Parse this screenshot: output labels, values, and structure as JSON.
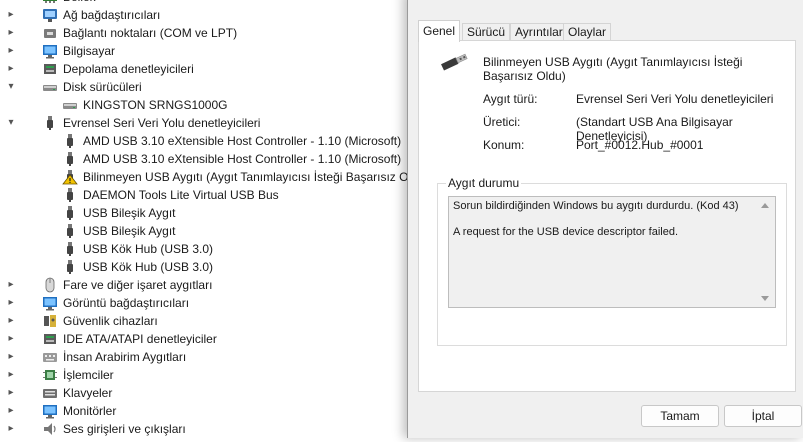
{
  "tree": {
    "items": [
      {
        "label": "Bellek",
        "indent": 0,
        "chevron": "▸",
        "icon": "mem"
      },
      {
        "label": "Ağ bağdaştırıcıları",
        "indent": 0,
        "chevron": "▸",
        "icon": "net"
      },
      {
        "label": "Bağlantı noktaları (COM ve LPT)",
        "indent": 0,
        "chevron": "▸",
        "icon": "port"
      },
      {
        "label": "Bilgisayar",
        "indent": 0,
        "chevron": "▸",
        "icon": "monitor"
      },
      {
        "label": "Depolama denetleyicileri",
        "indent": 0,
        "chevron": "▸",
        "icon": "storage"
      },
      {
        "label": "Disk sürücüleri",
        "indent": 0,
        "chevron": "▾",
        "icon": "disk"
      },
      {
        "label": "KINGSTON SRNGS1000G",
        "indent": 1,
        "chevron": "",
        "icon": "disk"
      },
      {
        "label": "Evrensel Seri Veri Yolu denetleyicileri",
        "indent": 0,
        "chevron": "▾",
        "icon": "usb"
      },
      {
        "label": "AMD USB 3.10 eXtensible Host Controller - 1.10 (Microsoft)",
        "indent": 1,
        "chevron": "",
        "icon": "usb"
      },
      {
        "label": "AMD USB 3.10 eXtensible Host Controller - 1.10 (Microsoft)",
        "indent": 1,
        "chevron": "",
        "icon": "usb"
      },
      {
        "label": "Bilinmeyen USB Aygıtı (Aygıt Tanımlayıcısı İsteği Başarısız Oldu)",
        "indent": 1,
        "chevron": "",
        "icon": "warn"
      },
      {
        "label": "DAEMON Tools Lite Virtual USB Bus",
        "indent": 1,
        "chevron": "",
        "icon": "usb"
      },
      {
        "label": "USB Bileşik Aygıt",
        "indent": 1,
        "chevron": "",
        "icon": "usb"
      },
      {
        "label": "USB Bileşik Aygıt",
        "indent": 1,
        "chevron": "",
        "icon": "usb"
      },
      {
        "label": "USB Kök Hub (USB 3.0)",
        "indent": 1,
        "chevron": "",
        "icon": "usb"
      },
      {
        "label": "USB Kök Hub (USB 3.0)",
        "indent": 1,
        "chevron": "",
        "icon": "usb"
      },
      {
        "label": "Fare ve diğer işaret aygıtları",
        "indent": 0,
        "chevron": "▸",
        "icon": "mouse"
      },
      {
        "label": "Görüntü bağdaştırıcıları",
        "indent": 0,
        "chevron": "▸",
        "icon": "monitor"
      },
      {
        "label": "Güvenlik cihazları",
        "indent": 0,
        "chevron": "▸",
        "icon": "security"
      },
      {
        "label": "IDE ATA/ATAPI denetleyiciler",
        "indent": 0,
        "chevron": "▸",
        "icon": "storage"
      },
      {
        "label": "İnsan Arabirim Aygıtları",
        "indent": 0,
        "chevron": "▸",
        "icon": "hid"
      },
      {
        "label": "İşlemciler",
        "indent": 0,
        "chevron": "▸",
        "icon": "cpu"
      },
      {
        "label": "Klavyeler",
        "indent": 0,
        "chevron": "▸",
        "icon": "keyboard"
      },
      {
        "label": "Monitörler",
        "indent": 0,
        "chevron": "▸",
        "icon": "monitor"
      },
      {
        "label": "Ses girişleri ve çıkışları",
        "indent": 0,
        "chevron": "▸",
        "icon": "audio"
      }
    ]
  },
  "dialog": {
    "tabs": [
      "Genel",
      "Sürücü",
      "Ayrıntılar",
      "Olaylar"
    ],
    "active_tab": "Genel",
    "device_name": "Bilinmeyen USB Aygıtı (Aygıt Tanımlayıcısı İsteği Başarısız Oldu)",
    "device_icon": "usb-plug-icon",
    "props": [
      {
        "label": "Aygıt türü:",
        "value": "Evrensel Seri Veri Yolu denetleyicileri"
      },
      {
        "label": "Üretici:",
        "value": "(Standart USB Ana Bilgisayar Denetleyicisi)"
      },
      {
        "label": "Konum:",
        "value": "Port_#0012.Hub_#0001"
      }
    ],
    "status_caption": "Aygıt durumu",
    "status_lines": [
      "Sorun bildirdiğinden Windows bu aygıtı durdurdu. (Kod 43)",
      "A request for the USB device descriptor failed."
    ],
    "ok_label": "Tamam",
    "cancel_label": "İptal"
  },
  "colors": {
    "warning": "#f2c200",
    "usb": "#555555",
    "accent": "#0067c0"
  }
}
